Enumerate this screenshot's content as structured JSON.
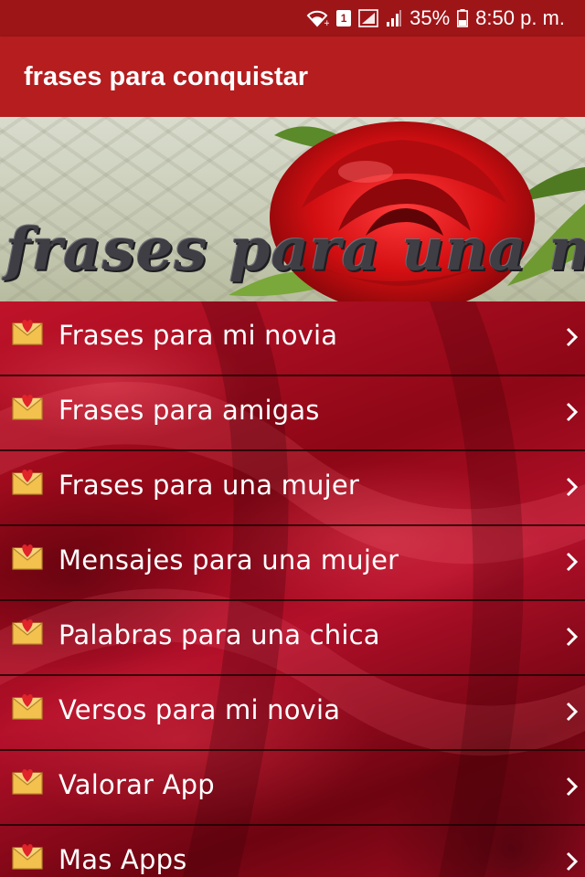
{
  "status_bar": {
    "sim_slot": "1",
    "battery_percent": "35%",
    "time": "8:50 p. m.",
    "icons": [
      "wifi-icon",
      "sim-badge-icon",
      "signal-icon",
      "signal-bars-icon",
      "battery-icon"
    ]
  },
  "app_bar": {
    "title": "frases para conquistar",
    "color": "#b51d1f"
  },
  "banner": {
    "text": "frases para una mujer"
  },
  "menu": {
    "items": [
      {
        "label": "Frases para mi novia",
        "icon": "love-letter-icon"
      },
      {
        "label": "Frases para amigas",
        "icon": "love-letter-icon"
      },
      {
        "label": "Frases para una mujer",
        "icon": "love-letter-icon"
      },
      {
        "label": "Mensajes para una mujer",
        "icon": "love-letter-icon"
      },
      {
        "label": "Palabras para una chica",
        "icon": "love-letter-icon"
      },
      {
        "label": "Versos para mi novia",
        "icon": "love-letter-icon"
      },
      {
        "label": "Valorar App",
        "icon": "love-letter-icon"
      },
      {
        "label": "Mas Apps",
        "icon": "love-letter-icon"
      }
    ]
  },
  "colors": {
    "status_bar": "#9e1518",
    "accent": "#b51d1f",
    "list_background": "#8d0716"
  }
}
